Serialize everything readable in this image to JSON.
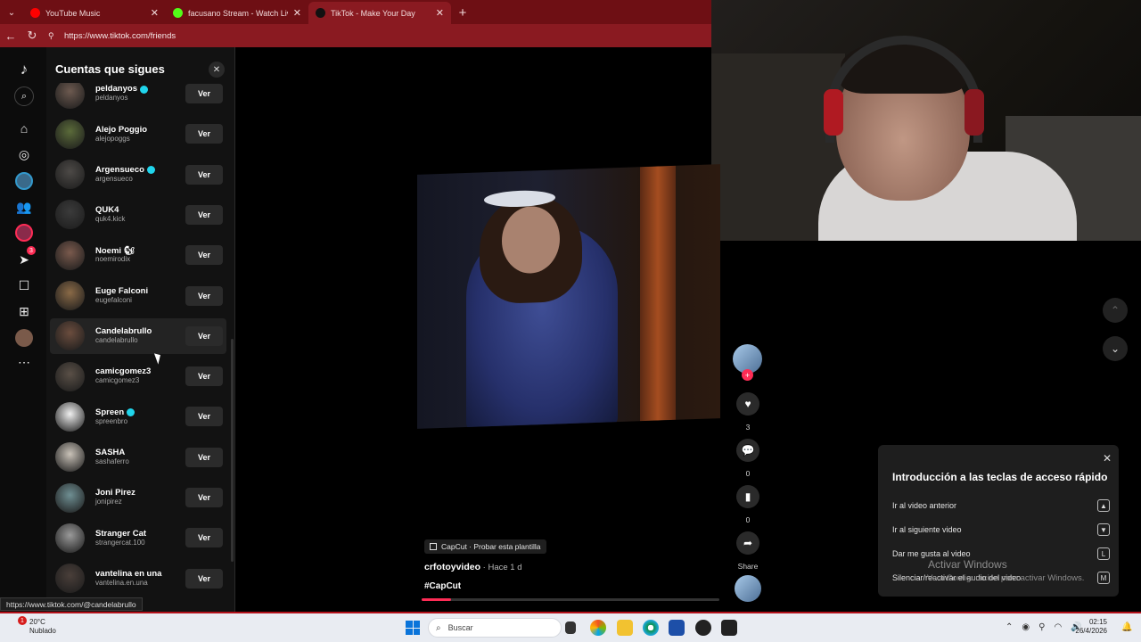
{
  "browser": {
    "tabs": [
      {
        "title": "YouTube Music",
        "color": "#ff0000",
        "active": false
      },
      {
        "title": "facusano Stream - Watch Live on K",
        "color": "#53fc18",
        "active": false
      },
      {
        "title": "TikTok - Make Your Day",
        "color": "#111111",
        "active": true
      }
    ],
    "url": "https://www.tiktok.com/friends"
  },
  "panel": {
    "title": "Cuentas que sigues",
    "button_label": "Ver",
    "accounts": [
      {
        "name": "peldanyos",
        "handle": "peldanyos",
        "verified": true,
        "emoji": "",
        "avatar_color": "#6d5a50"
      },
      {
        "name": "Alejo Poggio",
        "handle": "alejopoggs",
        "verified": false,
        "emoji": "",
        "avatar_color": "#5b6b3a"
      },
      {
        "name": "Argensueco",
        "handle": "argensueco",
        "verified": true,
        "emoji": "",
        "avatar_color": "#4d4a47"
      },
      {
        "name": "QUK4",
        "handle": "quk4.kick",
        "verified": false,
        "emoji": "",
        "avatar_color": "#3b3b3b"
      },
      {
        "name": "Noemi",
        "handle": "noemirodix",
        "verified": false,
        "emoji": "🐿",
        "avatar_color": "#7a5a4d"
      },
      {
        "name": "Euge Falconi",
        "handle": "eugefalconi",
        "verified": false,
        "emoji": "",
        "avatar_color": "#8a6a47"
      },
      {
        "name": "Candelabrullo",
        "handle": "candelabrullo",
        "verified": false,
        "emoji": "",
        "avatar_color": "#6b4d3e"
      },
      {
        "name": "camicgomez3",
        "handle": "camicgomez3",
        "verified": false,
        "emoji": "",
        "avatar_color": "#5a5047"
      },
      {
        "name": "Spreen",
        "handle": "spreenbro",
        "verified": true,
        "emoji": "",
        "avatar_color": "#f0f0f0"
      },
      {
        "name": "SASHA",
        "handle": "sashaferro",
        "verified": false,
        "emoji": "",
        "avatar_color": "#c9c2b8"
      },
      {
        "name": "Joni Pirez",
        "handle": "jonipirez",
        "verified": false,
        "emoji": "",
        "avatar_color": "#6f8f93"
      },
      {
        "name": "Stranger Cat",
        "handle": "strangercat.100",
        "verified": false,
        "emoji": "",
        "avatar_color": "#9a9a9a"
      },
      {
        "name": "vantelina en una",
        "handle": "vantelina.en.una",
        "verified": false,
        "emoji": "",
        "avatar_color": "#4a3f3a"
      }
    ],
    "hovered_index": 6
  },
  "status_url": "https://www.tiktok.com/@candelabrullo",
  "video": {
    "capcut_label": "CapCut · Probar esta plantilla",
    "author": "crfotoyvideo",
    "time": " · Hace 1 d",
    "hashtag": "#CapCut",
    "progress": 0.1
  },
  "actions": {
    "likes": "3",
    "comments": "0",
    "saves": "0",
    "share_label": "Share"
  },
  "shortcuts": {
    "title": "Introducción a las teclas de acceso rápido",
    "rows": [
      {
        "label": "Ir al video anterior",
        "key": "▲"
      },
      {
        "label": "Ir al siguiente video",
        "key": "▼"
      },
      {
        "label": "Dar me gusta al video",
        "key": "L"
      },
      {
        "label": "Silenciar/reactivar el audio del video",
        "key": "M"
      }
    ]
  },
  "watermark": {
    "title": "Activar Windows",
    "subtitle": "Ve a Configuración para activar Windows."
  },
  "taskbar": {
    "temp": "20°C",
    "condition": "Nublado",
    "search_placeholder": "Buscar",
    "time": "02:15",
    "date": "26/4/2026",
    "alert_count": "1"
  },
  "nav_badge": "3"
}
